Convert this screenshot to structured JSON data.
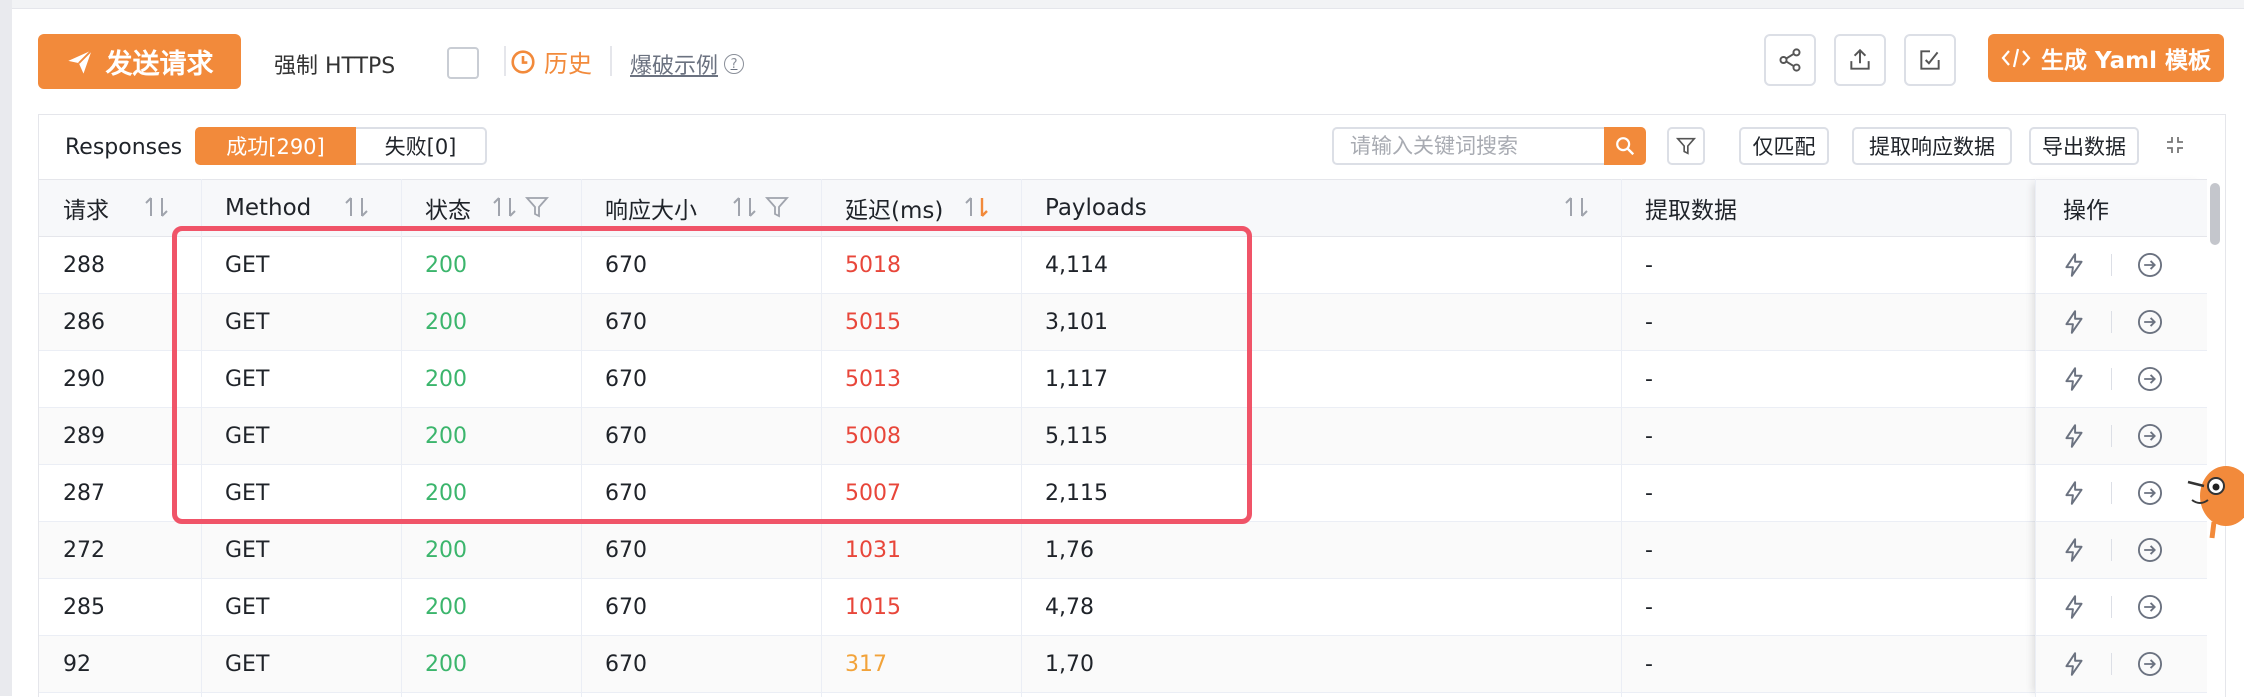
{
  "toolbar": {
    "send_label": "发送请求",
    "force_https_label": "强制 HTTPS",
    "force_https_checked": false,
    "history_label": "历史",
    "example_label": "爆破示例",
    "yaml_label": "生成 Yaml 模板"
  },
  "responses": {
    "label": "Responses",
    "success_tab": "成功[290]",
    "fail_tab": "失败[0]",
    "search_placeholder": "请输入关键词搜索",
    "match_only_label": "仅匹配",
    "extract_label": "提取响应数据",
    "export_label": "导出数据"
  },
  "table": {
    "columns": [
      "请求",
      "Method",
      "状态",
      "响应大小",
      "延迟(ms)",
      "Payloads",
      "提取数据",
      "操作"
    ],
    "rows": [
      {
        "id": "288",
        "method": "GET",
        "status": "200",
        "size": "670",
        "latency": "5018",
        "latency_color": "red",
        "payloads": "4,114",
        "extracted": "-"
      },
      {
        "id": "286",
        "method": "GET",
        "status": "200",
        "size": "670",
        "latency": "5015",
        "latency_color": "red",
        "payloads": "3,101",
        "extracted": "-"
      },
      {
        "id": "290",
        "method": "GET",
        "status": "200",
        "size": "670",
        "latency": "5013",
        "latency_color": "red",
        "payloads": "1,117",
        "extracted": "-"
      },
      {
        "id": "289",
        "method": "GET",
        "status": "200",
        "size": "670",
        "latency": "5008",
        "latency_color": "red",
        "payloads": "5,115",
        "extracted": "-"
      },
      {
        "id": "287",
        "method": "GET",
        "status": "200",
        "size": "670",
        "latency": "5007",
        "latency_color": "red",
        "payloads": "2,115",
        "extracted": "-"
      },
      {
        "id": "272",
        "method": "GET",
        "status": "200",
        "size": "670",
        "latency": "1031",
        "latency_color": "red",
        "payloads": "1,76",
        "extracted": "-"
      },
      {
        "id": "285",
        "method": "GET",
        "status": "200",
        "size": "670",
        "latency": "1015",
        "latency_color": "red",
        "payloads": "4,78",
        "extracted": "-"
      },
      {
        "id": "92",
        "method": "GET",
        "status": "200",
        "size": "670",
        "latency": "317",
        "latency_color": "orange",
        "payloads": "1,70",
        "extracted": "-"
      }
    ]
  },
  "colors": {
    "accent": "#f28a3b",
    "success": "#3bb56c",
    "danger": "#e8463a",
    "warning": "#f2a33a",
    "highlight_box": "#f05468"
  },
  "icons": [
    "send-icon",
    "clock-icon",
    "help-icon",
    "share-icon",
    "upload-icon",
    "edit-check-icon",
    "code-icon",
    "search-icon",
    "filter-icon",
    "collapse-icon",
    "sort-icon",
    "lightning-icon",
    "arrow-circle-icon"
  ]
}
